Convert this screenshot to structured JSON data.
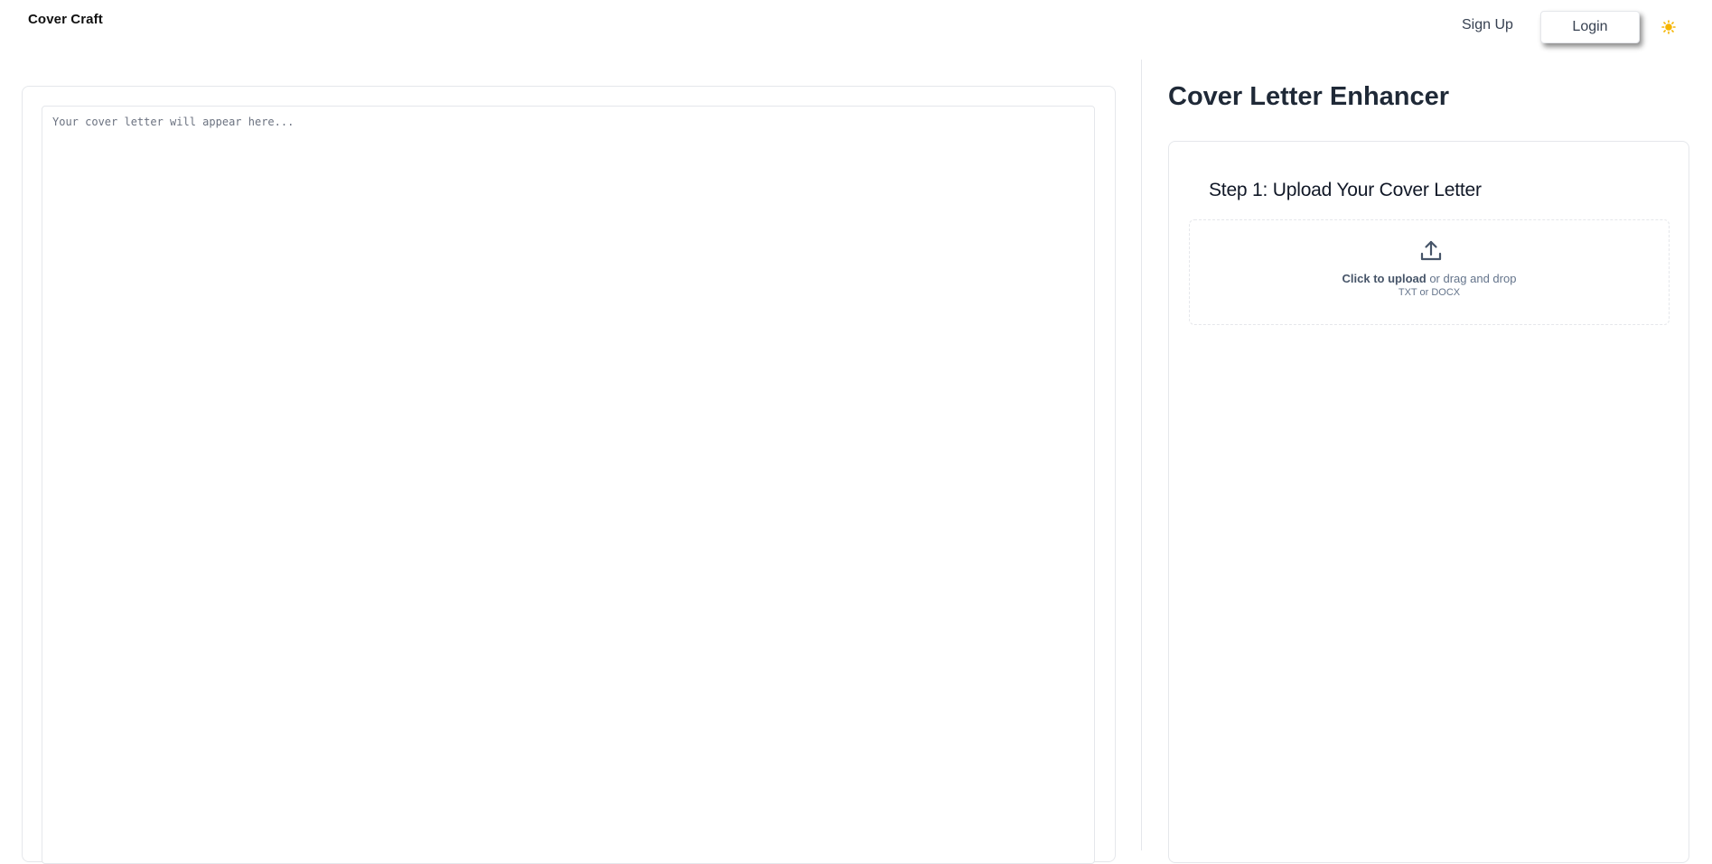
{
  "header": {
    "brand": "Cover Craft",
    "signup_label": "Sign Up",
    "login_label": "Login",
    "theme_icon": "sun-icon",
    "theme_icon_color": "#f5b400"
  },
  "editor": {
    "placeholder": "Your cover letter will appear here...",
    "value": ""
  },
  "enhancer": {
    "title": "Cover Letter Enhancer",
    "step1_title": "Step 1: Upload Your Cover Letter",
    "upload": {
      "icon": "upload-icon",
      "action_label": "Click to upload",
      "action_suffix": " or drag and drop",
      "formats": "TXT or DOCX"
    }
  },
  "colors": {
    "border": "#e5e7eb",
    "text_muted": "#64748b",
    "accent_sun": "#f5b400"
  }
}
